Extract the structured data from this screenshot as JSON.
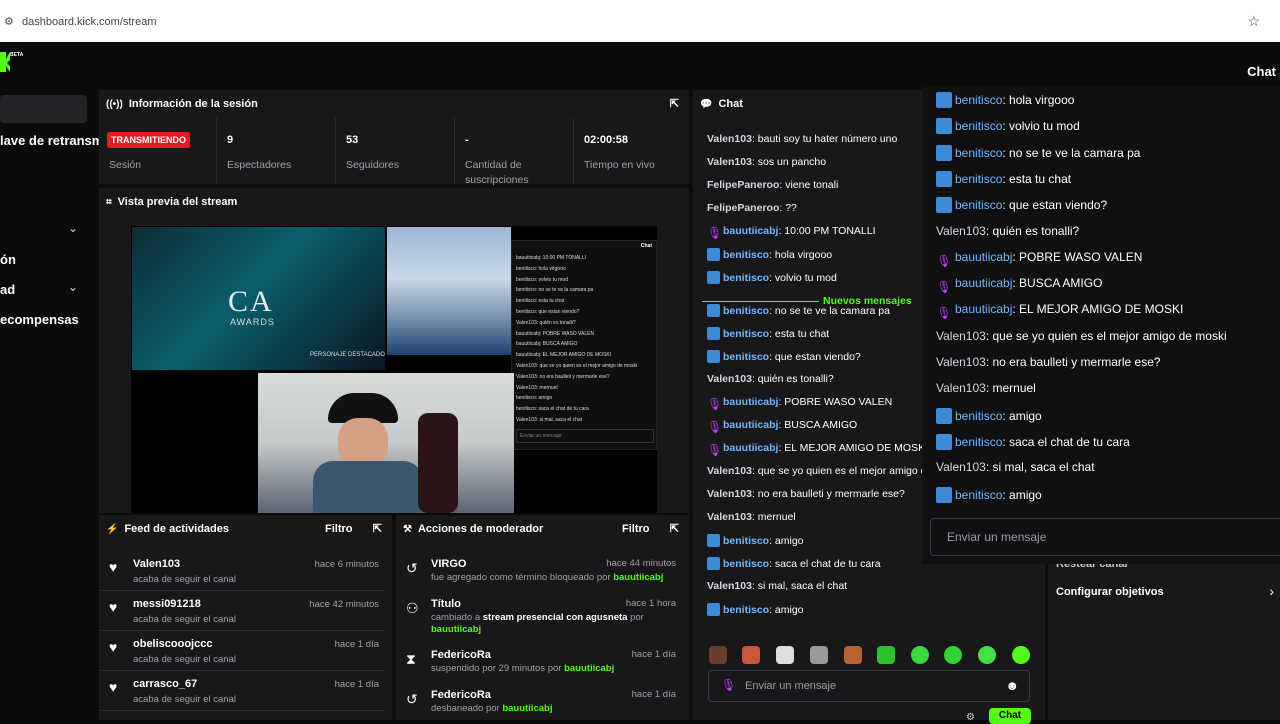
{
  "browser": {
    "url": "dashboard.kick.com/stream"
  },
  "topnav": {
    "beta": "BETA",
    "chat_label": "Chat"
  },
  "sidebar": {
    "items": [
      "lave de retransm",
      "ón",
      "ad",
      "ecompensas"
    ]
  },
  "session": {
    "title": "Información de la sesión",
    "stats": [
      {
        "value": "TRANSMITIENDO",
        "label": "Sesión"
      },
      {
        "value": "9",
        "label": "Espectadores"
      },
      {
        "value": "53",
        "label": "Seguidores"
      },
      {
        "value": "-",
        "label": "Cantidad de suscripciones"
      },
      {
        "value": "02:00:58",
        "label": "Tiempo en vivo"
      }
    ]
  },
  "preview": {
    "title": "Vista previa del stream",
    "awards_title": "CA",
    "awards_sub": "AWARDS",
    "nominee": "PERSONAJE DESTACADO",
    "mini_chat_title": "Chat",
    "mini_input": "Enviar un mensaje",
    "mini_msgs": [
      "bauutiicabj: 10:00 PM TONALLI",
      "benitisco: hola virgooo",
      "benitisco: volvio tu mod",
      "benitisco: no se te ve la camara pa",
      "benitisco: esta tu chat",
      "benitisco: que estan viendo?",
      "Valen103: quién es tonalli?",
      "bauutiicabj: POBRE WASO VALEN",
      "bauutiicabj: BUSCA AMIGO",
      "bauutiicabj: EL MEJOR AMIGO DE MOSKI",
      "Valen103: que se yo quien es el mejor amigo de moski",
      "Valen103: no era baulleti y mermarle ese?",
      "Valen103: mernuel",
      "benitisco: amigo",
      "benitisco: saca el chat de tu cara",
      "Valen103: si mal, saca el chat"
    ]
  },
  "feed": {
    "title": "Feed de actividades",
    "filter": "Filtro",
    "rows": [
      {
        "user": "Valen103",
        "desc": "acaba de seguir el canal",
        "time": "hace 6 minutos"
      },
      {
        "user": "messi091218",
        "desc": "acaba de seguir el canal",
        "time": "hace 42 minutos"
      },
      {
        "user": "obeliscooojccc",
        "desc": "acaba de seguir el canal",
        "time": "hace 1 día"
      },
      {
        "user": "carrasco_67",
        "desc": "acaba de seguir el canal",
        "time": "hace 1 día"
      }
    ]
  },
  "mod": {
    "title": "Acciones de moderador",
    "filter": "Filtro",
    "rows": [
      {
        "user": "VIRGO",
        "time": "hace 44 minutos",
        "d1": "fue agregado como término bloqueado por ",
        "d2": "bauutiicabj",
        "d3": ""
      },
      {
        "user": "Título",
        "time": "hace 1 hora",
        "d1": "cambiado a ",
        "d2": "stream presencial con agusneta",
        "d3": " por ",
        "d4": "bauutiicabj"
      },
      {
        "user": "FedericoRa",
        "time": "hace 1 día",
        "d1": "suspendido por 29 minutos por ",
        "d2": "bauutiicabj"
      },
      {
        "user": "FedericoRa",
        "time": "hace 1 día",
        "d1": "desbaneado por ",
        "d2": "bauutiicabj"
      }
    ]
  },
  "chat": {
    "title": "Chat",
    "new_messages": "Nuevos mensajes",
    "input_placeholder": "Enviar un mensaje",
    "send_label": "Chat",
    "messages": [
      {
        "user": "Valen103",
        "text": ": bauti soy tu hater número uno",
        "badge": "none"
      },
      {
        "user": "Valen103",
        "text": ": sos un pancho",
        "badge": "none"
      },
      {
        "user": "FelipePaneroo",
        "text": ": viene tonali",
        "badge": "none"
      },
      {
        "user": "FelipePaneroo",
        "text": ": ??",
        "badge": "none"
      },
      {
        "user": "bauutiicabj",
        "text": ": 10:00 PM TONALLI",
        "badge": "purple"
      },
      {
        "user": "benitisco",
        "text": ": hola virgooo",
        "badge": "blue"
      },
      {
        "user": "benitisco",
        "text": ": volvio tu mod",
        "badge": "blue"
      },
      {
        "user": "benitisco",
        "text": ": no se te ve la camara pa",
        "badge": "blue"
      },
      {
        "user": "benitisco",
        "text": ": esta tu chat",
        "badge": "blue"
      },
      {
        "user": "benitisco",
        "text": ": que estan viendo?",
        "badge": "blue"
      },
      {
        "user": "Valen103",
        "text": ": quién es tonalli?",
        "badge": "none"
      },
      {
        "user": "bauutiicabj",
        "text": ": POBRE WASO VALEN",
        "badge": "purple"
      },
      {
        "user": "bauutiicabj",
        "text": ": BUSCA AMIGO",
        "badge": "purple"
      },
      {
        "user": "bauutiicabj",
        "text": ": EL MEJOR AMIGO DE MOSKI",
        "badge": "purple"
      },
      {
        "user": "Valen103",
        "text": ": que se yo quien es el mejor amigo d",
        "badge": "none"
      },
      {
        "user": "Valen103",
        "text": ": no era baulleti y mermarle ese?",
        "badge": "none"
      },
      {
        "user": "Valen103",
        "text": ": mernuel",
        "badge": "none"
      },
      {
        "user": "benitisco",
        "text": ": amigo",
        "badge": "blue"
      },
      {
        "user": "benitisco",
        "text": ": saca el chat de tu cara",
        "badge": "blue"
      },
      {
        "user": "Valen103",
        "text": ": si mal, saca el chat",
        "badge": "none"
      },
      {
        "user": "benitisco",
        "text": ": amigo",
        "badge": "blue"
      }
    ]
  },
  "overlay": {
    "input_placeholder": "Enviar un mensaje",
    "messages": [
      {
        "user": "benitisco",
        "text": ": hola virgooo",
        "badge": "blue"
      },
      {
        "user": "benitisco",
        "text": ": volvio tu mod",
        "badge": "blue"
      },
      {
        "user": "benitisco",
        "text": ": no se te ve la camara pa",
        "badge": "blue"
      },
      {
        "user": "benitisco",
        "text": ": esta tu chat",
        "badge": "blue"
      },
      {
        "user": "benitisco",
        "text": ": que estan viendo?",
        "badge": "blue"
      },
      {
        "user": "Valen103",
        "text": ": quién es tonalli?",
        "badge": "none"
      },
      {
        "user": "bauutiicabj",
        "text": ": POBRE WASO VALEN",
        "badge": "purple"
      },
      {
        "user": "bauutiicabj",
        "text": ": BUSCA AMIGO",
        "badge": "purple"
      },
      {
        "user": "bauutiicabj",
        "text": ": EL MEJOR AMIGO DE MOSKI",
        "badge": "purple"
      },
      {
        "user": "Valen103",
        "text": ": que se yo quien es el mejor amigo de moski",
        "badge": "none"
      },
      {
        "user": "Valen103",
        "text": ": no era baulleti y mermarle ese?",
        "badge": "none"
      },
      {
        "user": "Valen103",
        "text": ": mernuel",
        "badge": "none"
      },
      {
        "user": "benitisco",
        "text": ": amigo",
        "badge": "blue"
      },
      {
        "user": "benitisco",
        "text": ": saca el chat de tu cara",
        "badge": "blue"
      },
      {
        "user": "Valen103",
        "text": ": si mal, saca el chat",
        "badge": "none"
      },
      {
        "user": "benitisco",
        "text": ": amigo",
        "badge": "blue"
      }
    ]
  },
  "right_panel": {
    "item1": "Restear canal",
    "item2": "Configurar objetivos"
  },
  "colors": {
    "accent": "#53fc18",
    "live": "#e01b24",
    "user_blue": "#6fb8ff",
    "badge_purple": "#c43fff"
  }
}
